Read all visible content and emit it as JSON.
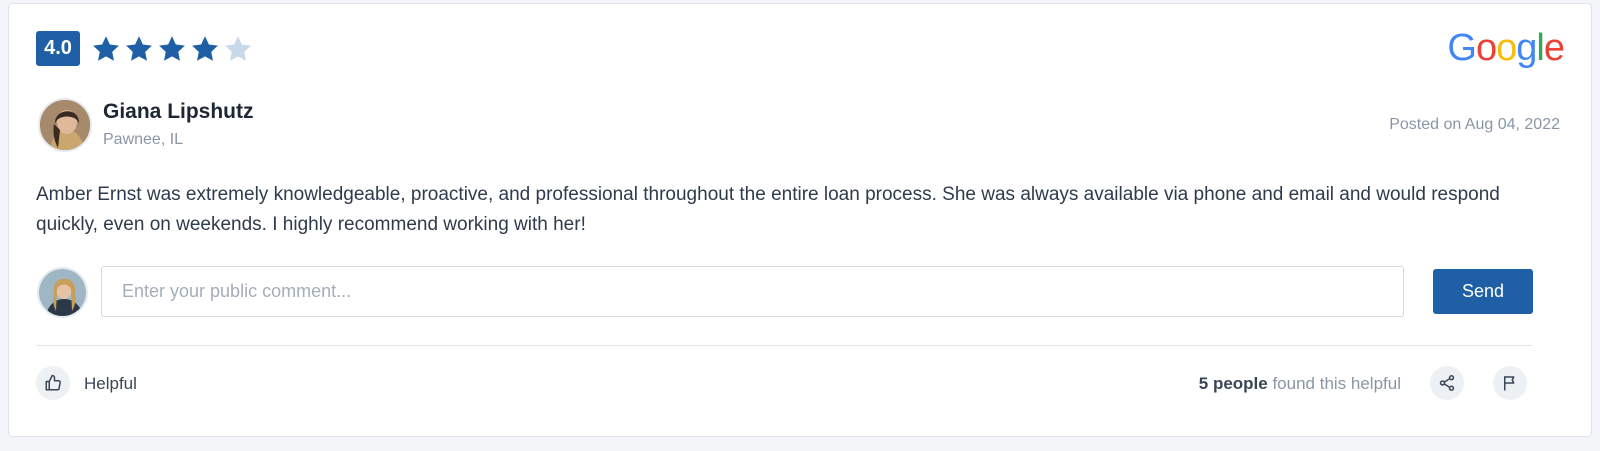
{
  "review": {
    "rating": "4.0",
    "stars_filled": 4,
    "stars_total": 5,
    "source_logo": [
      "G",
      "o",
      "o",
      "g",
      "l",
      "e"
    ],
    "source_logo_colors": [
      "#4285F4",
      "#EA4335",
      "#FBBC05",
      "#4285F4",
      "#34A853",
      "#EA4335"
    ],
    "reviewer_name": "Giana Lipshutz",
    "reviewer_location": "Pawnee, IL",
    "posted": "Posted on Aug 04, 2022",
    "text": "Amber Ernst was extremely knowledgeable, proactive, and professional throughout the entire loan process. She was always available via phone and email and would respond quickly, even on weekends. I highly recommend working with her!"
  },
  "comment": {
    "placeholder": "Enter your public comment...",
    "value": "",
    "send_label": "Send"
  },
  "footer": {
    "helpful_label": "Helpful",
    "helpful_count": "5 people",
    "helpful_suffix": " found this helpful"
  },
  "colors": {
    "accent": "#1f5fa6",
    "star_filled": "#1f5fa6",
    "star_empty": "#c9d9ec"
  }
}
